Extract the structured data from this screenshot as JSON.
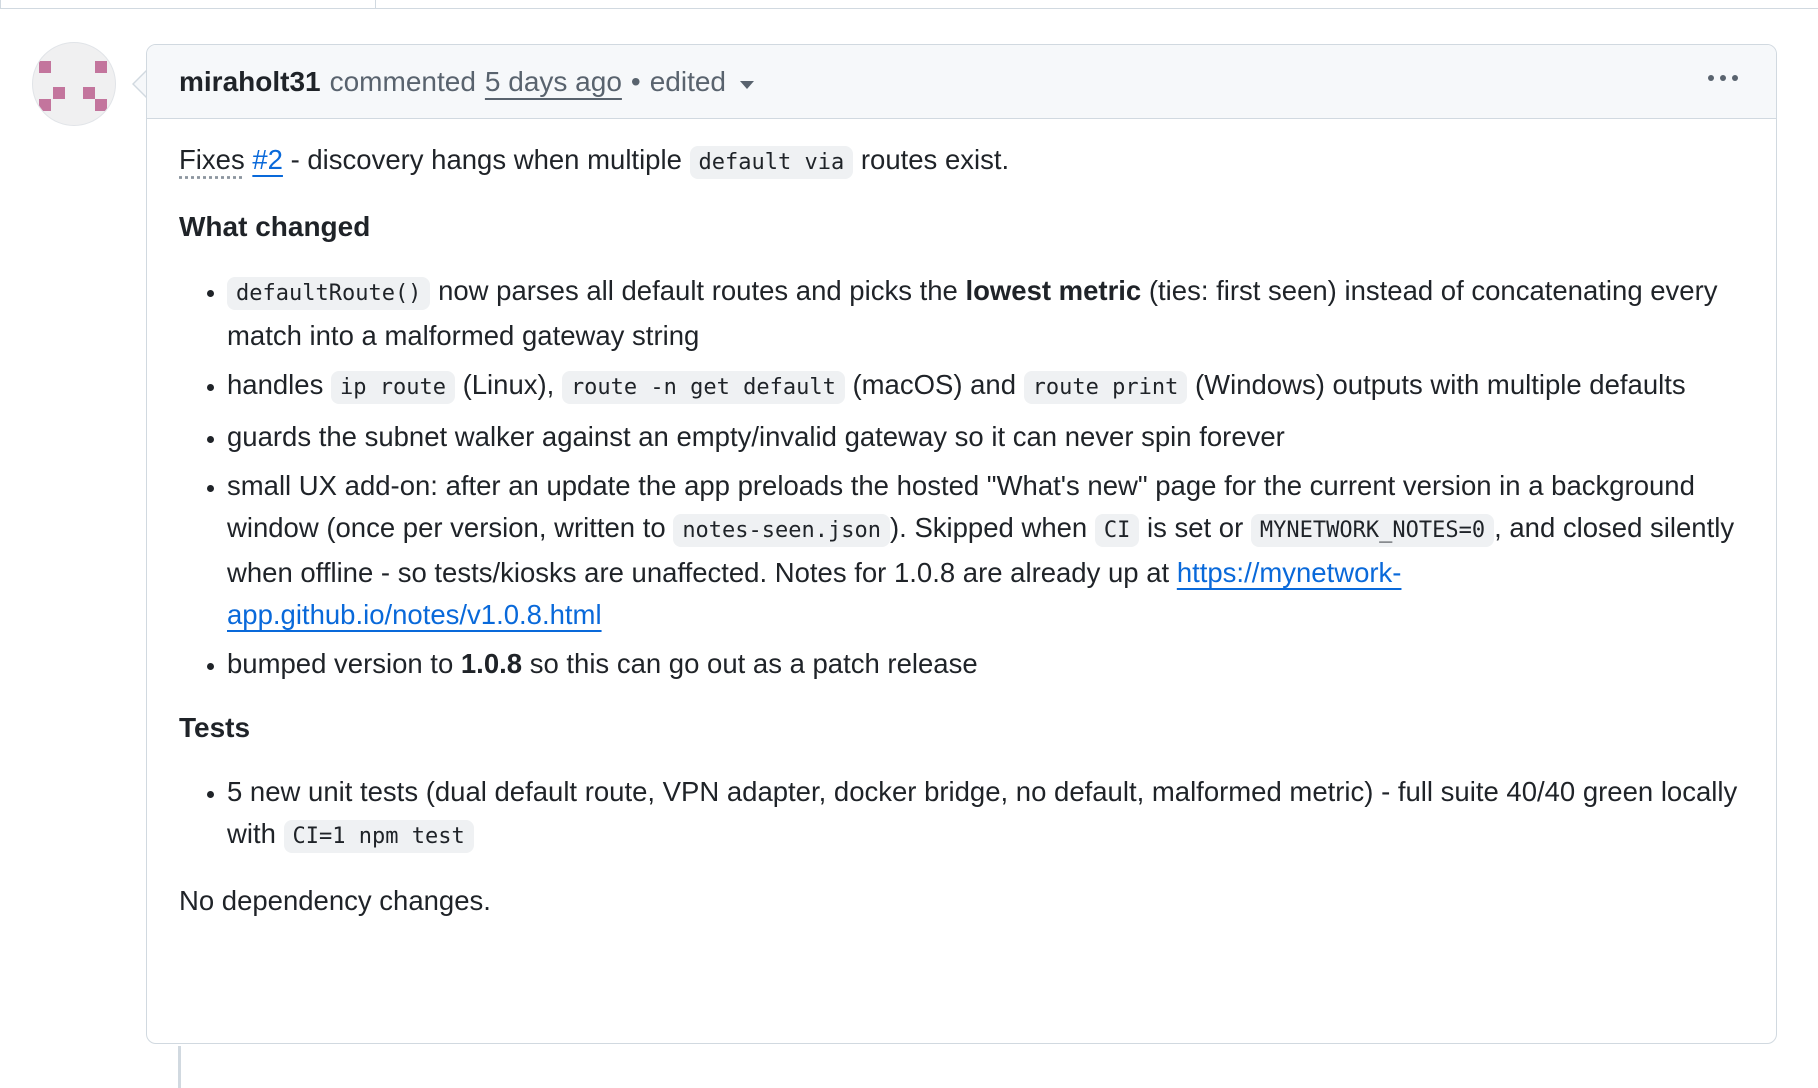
{
  "comment": {
    "author": "miraholt31",
    "action": "commented",
    "timestamp": "5 days ago",
    "separator": "•",
    "edited_label": "edited",
    "menu_icon": "kebab-horizontal-icon"
  },
  "body": {
    "intro_prefix": "Fixes",
    "intro_issue": "#2",
    "intro_middle": " - discovery hangs when multiple ",
    "intro_code": "default via",
    "intro_suffix": " routes exist.",
    "section1_heading": "What changed",
    "item1_code": "defaultRoute()",
    "item1_text_a": " now parses all default routes and picks the ",
    "item1_bold": "lowest metric",
    "item1_text_b": " (ties: first seen) instead of concatenating every match into a malformed gateway string",
    "item2_text_a": "handles ",
    "item2_code_a": "ip route",
    "item2_text_b": " (Linux), ",
    "item2_code_b": "route -n get default",
    "item2_text_c": " (macOS) and ",
    "item2_code_c": "route print",
    "item2_text_d": " (Windows) outputs with multiple defaults",
    "item3_text": "guards the subnet walker against an empty/invalid gateway so it can never spin forever",
    "item4_text_a": "small UX add-on: after an update the app preloads the hosted \"What's new\" page for the current version in a background window (once per version, written to ",
    "item4_code_a": "notes-seen.json",
    "item4_text_b": "). Skipped when ",
    "item4_code_b": "CI",
    "item4_text_c": " is set or ",
    "item4_code_c": "MYNETWORK_NOTES=0",
    "item4_text_d": ", and closed silently when offline - so tests/kiosks are unaffected. Notes for 1.0.8 are already up at ",
    "item4_link": "https://mynetwork-app.github.io/notes/v1.0.8.html",
    "item5_text_a": "bumped version to ",
    "item5_bold": "1.0.8",
    "item5_text_b": " so this can go out as a patch release",
    "section2_heading": "Tests",
    "test1_text": "5 new unit tests (dual default route, VPN adapter, docker bridge, no default, malformed metric) - full suite 40/40 green locally with ",
    "test1_code": "CI=1 npm test",
    "footer": "No dependency changes."
  },
  "colors": {
    "link": "#0969da",
    "avatar": "#c3759d",
    "border": "#d1d9e0",
    "header_bg": "#f6f8fa"
  }
}
